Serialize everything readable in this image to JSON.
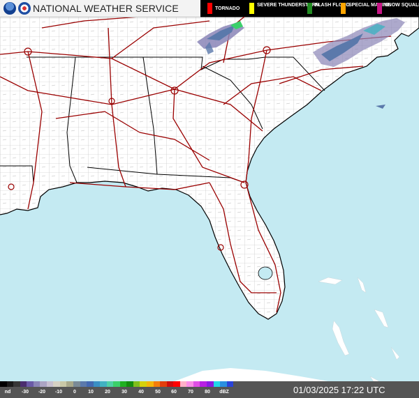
{
  "header": {
    "title": "NATIONAL WEATHER SERVICE",
    "logos": [
      "noaa-logo",
      "nws-logo"
    ]
  },
  "warnings_legend": {
    "items": [
      {
        "label": "TORNADO",
        "color": "#ff0000"
      },
      {
        "label": "SEVERE THUNDERSTORM",
        "color": "#ffff00"
      },
      {
        "label": "FLASH FLOOD",
        "color": "#228b22"
      },
      {
        "label": "SPECIAL MARINE",
        "color": "#ffa500"
      },
      {
        "label": "SNOW SQUALL",
        "color": "#c71585"
      }
    ]
  },
  "dbz_scale": {
    "colors": [
      "#000000",
      "#1a1a1a",
      "#373737",
      "#4a2d6e",
      "#6a5aa7",
      "#8a85b7",
      "#aba4c3",
      "#c7c0d0",
      "#d6d2c4",
      "#c9c8a7",
      "#a8a88a",
      "#7a8a96",
      "#5b79ab",
      "#4369b1",
      "#3a8fc4",
      "#41b2c2",
      "#4fd1a6",
      "#3bd06a",
      "#1fb021",
      "#138c0e",
      "#7fbe1c",
      "#d6d20c",
      "#f5b60a",
      "#f47d0b",
      "#e23e0c",
      "#ce0c0c",
      "#ff0000",
      "#ffb0c8",
      "#f98ce8",
      "#e04fe6",
      "#b81fe3",
      "#8a1ae2",
      "#1fd6e6",
      "#2a8fe0",
      "#2a43d8"
    ],
    "labels": [
      "nd",
      "-30",
      "-20",
      "-10",
      "0",
      "10",
      "20",
      "30",
      "40",
      "50",
      "60",
      "70",
      "80",
      "dBZ"
    ],
    "unit": "dBZ"
  },
  "timestamp": "01/03/2025 17:22 UTC",
  "map": {
    "water_color": "#c4eaf2",
    "land_color": "#ffffff",
    "county_line_color": "#b0b0b0",
    "state_line_color": "#000000",
    "interstate_color": "#9a0000",
    "precip_colors": [
      "#5b79ab",
      "#8a85b7",
      "#41b2c2",
      "#3bd06a"
    ]
  }
}
